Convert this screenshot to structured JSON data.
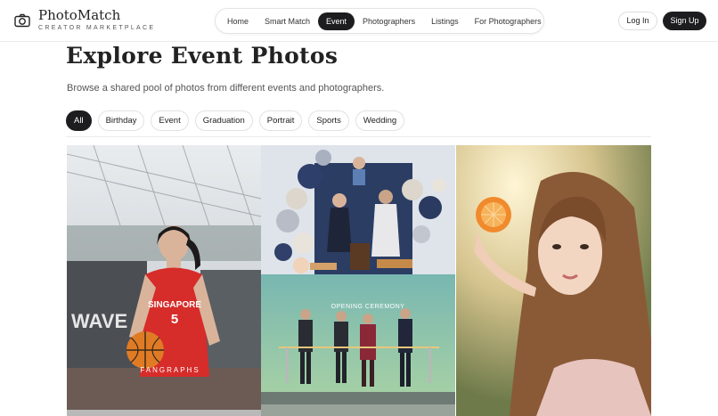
{
  "brand": {
    "name": "PhotoMatch",
    "tagline": "CREATOR MARKETPLACE",
    "logo_icon": "camera-icon"
  },
  "nav": {
    "items": [
      {
        "label": "Home",
        "active": false
      },
      {
        "label": "Smart Match",
        "active": false
      },
      {
        "label": "Event",
        "active": true
      },
      {
        "label": "Photographers",
        "active": false
      },
      {
        "label": "Listings",
        "active": false
      },
      {
        "label": "For Photographers",
        "active": false
      }
    ]
  },
  "auth": {
    "login_label": "Log In",
    "signup_label": "Sign Up"
  },
  "page": {
    "title": "Explore Event Photos",
    "subtitle": "Browse a shared pool of photos from different events and photographers."
  },
  "filters": {
    "items": [
      {
        "label": "All",
        "active": true
      },
      {
        "label": "Birthday",
        "active": false
      },
      {
        "label": "Event",
        "active": false
      },
      {
        "label": "Graduation",
        "active": false
      },
      {
        "label": "Portrait",
        "active": false
      },
      {
        "label": "Sports",
        "active": false
      },
      {
        "label": "Wedding",
        "active": false
      }
    ]
  },
  "gallery": {
    "photos": [
      {
        "subject": "basketball player",
        "jersey_text": "SINGAPORE",
        "jersey_number": "5",
        "watermark": "FANGRAPHS",
        "banner": "WAVE"
      },
      {
        "subject": "birthday balloons"
      },
      {
        "subject": "opening ceremony",
        "banner": "OPENING CEREMONY"
      },
      {
        "subject": "portrait with orange"
      }
    ]
  },
  "colors": {
    "accent": "#1d1d1f",
    "border": "#e4e4e4",
    "background": "#ffffff"
  }
}
